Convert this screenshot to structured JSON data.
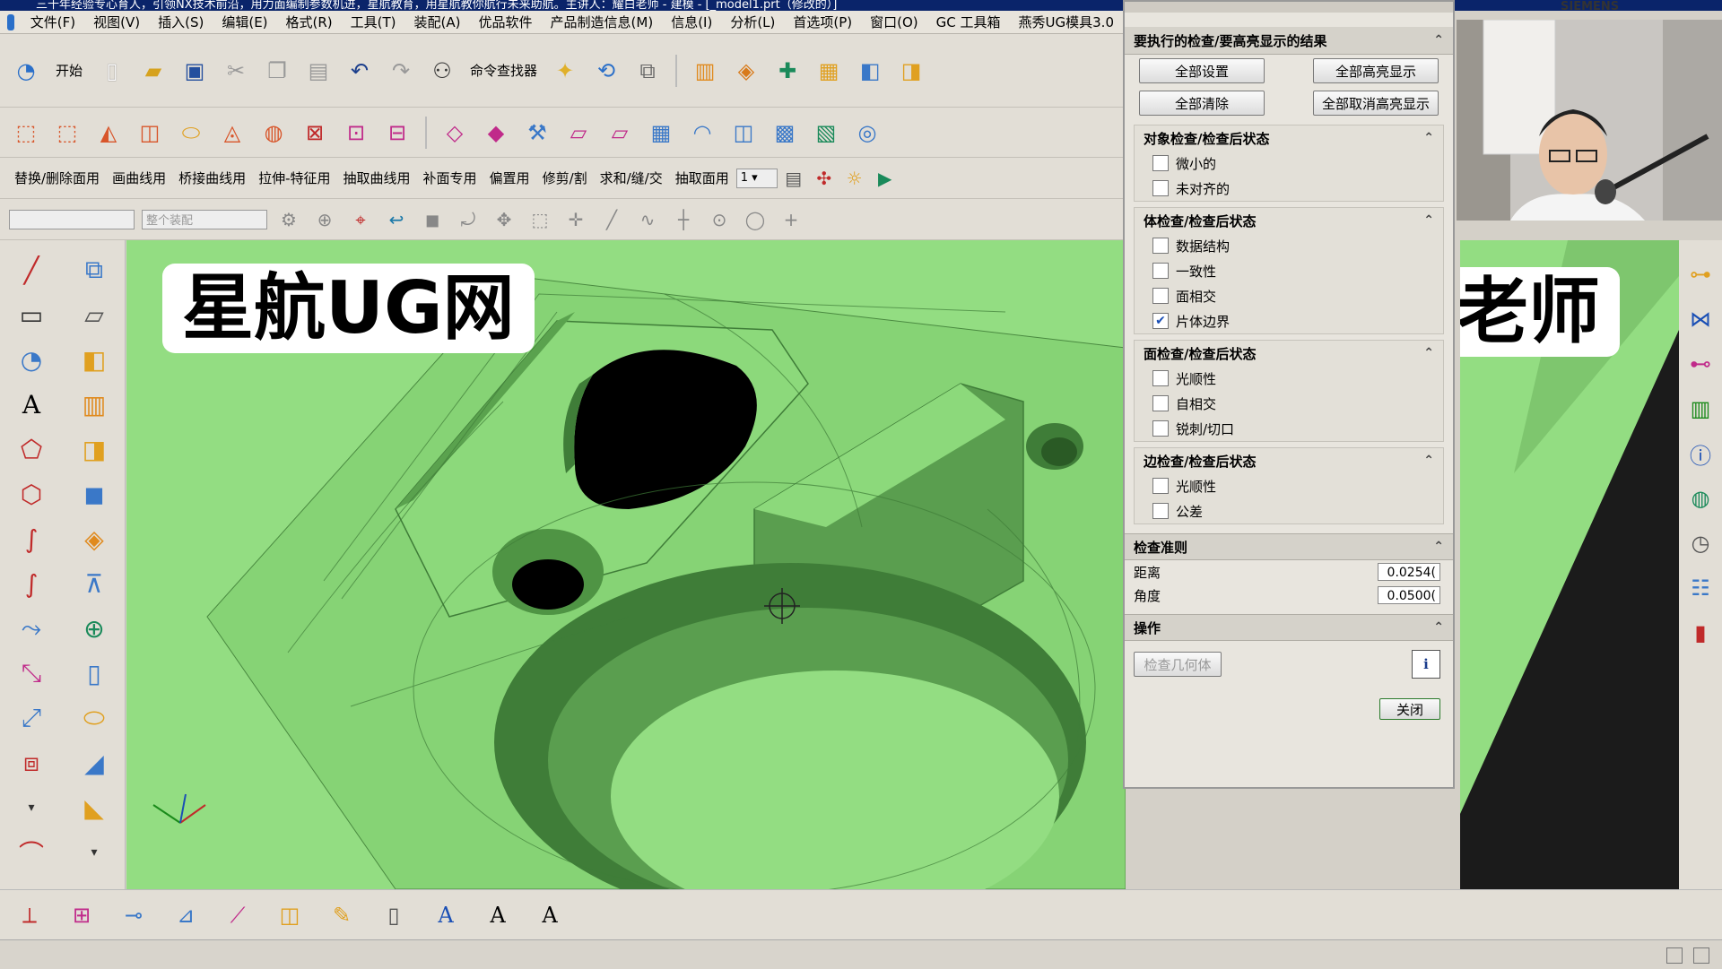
{
  "window": {
    "title": "三十年经验专心育人，引领NX技术前沿，用力面编制参数机进，星航教育，用星航教你航行未来助航。主讲人：耀白老师 - 建模 - [_model1.prt（修改的）]",
    "brand": "SIEMENS"
  },
  "menu": {
    "items": [
      "文件(F)",
      "视图(V)",
      "插入(S)",
      "编辑(E)",
      "格式(R)",
      "工具(T)",
      "装配(A)",
      "优品软件",
      "产品制造信息(M)",
      "信息(I)",
      "分析(L)",
      "首选项(P)",
      "窗口(O)",
      "GC 工具箱",
      "燕秀UG模具3.0"
    ]
  },
  "toolbar1": {
    "start_label": "开始",
    "finder_label": "命令查找器"
  },
  "toolbar3": {
    "menus": [
      "替换/删除面用",
      "画曲线用",
      "桥接曲线用",
      "拉伸-特征用",
      "抽取曲线用",
      "补面专用",
      "偏置用",
      "修剪/割",
      "求和/缝/交",
      "抽取面用"
    ],
    "layer_value": "1"
  },
  "toolbar4": {
    "combo2": "整个装配"
  },
  "watermarks": {
    "left": "星航UG网",
    "right": "耀白老师"
  },
  "dialog": {
    "results_title": "要执行的检查/要高亮显示的结果",
    "buttons": {
      "set_all": "全部设置",
      "highlight_all": "全部高亮显示",
      "clear_all": "全部清除",
      "unhighlight_all": "全部取消高亮显示"
    },
    "object_group": {
      "title": "对象检查/检查后状态",
      "items": [
        {
          "label": "微小的",
          "checked": false
        },
        {
          "label": "未对齐的",
          "checked": false
        }
      ]
    },
    "body_group": {
      "title": "体检查/检查后状态",
      "items": [
        {
          "label": "数据结构",
          "checked": false
        },
        {
          "label": "一致性",
          "checked": false
        },
        {
          "label": "面相交",
          "checked": false
        },
        {
          "label": "片体边界",
          "checked": true
        }
      ]
    },
    "face_group": {
      "title": "面检查/检查后状态",
      "items": [
        {
          "label": "光顺性",
          "checked": false
        },
        {
          "label": "自相交",
          "checked": false
        },
        {
          "label": "锐刺/切口",
          "checked": false
        }
      ]
    },
    "edge_group": {
      "title": "边检查/检查后状态",
      "items": [
        {
          "label": "光顺性",
          "checked": false
        },
        {
          "label": "公差",
          "checked": false
        }
      ]
    },
    "criteria": {
      "title": "检查准则",
      "distance_label": "距离",
      "distance_value": "0.0254(",
      "angle_label": "角度",
      "angle_value": "0.0500("
    },
    "operation": {
      "title": "操作",
      "check_button": "检查几何体"
    },
    "close_button": "关闭"
  },
  "colors": {
    "viewport_green": "#93dd82",
    "part_shadow": "#3f7d38",
    "hole_black": "#000000"
  }
}
